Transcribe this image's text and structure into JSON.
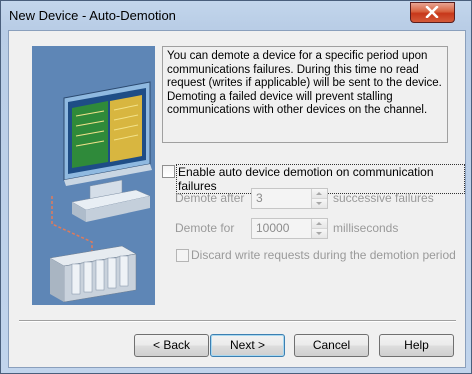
{
  "window": {
    "title": "New Device - Auto-Demotion"
  },
  "description": "You can demote a device for a specific period upon communications failures. During this time no read request (writes if applicable) will be sent to the device. Demoting a failed device will prevent stalling communications with other devices on the channel.",
  "enable": {
    "label": "Enable auto device demotion on communication failures",
    "checked": false
  },
  "demote_after": {
    "label": "Demote after",
    "value": "3",
    "suffix": "successive failures"
  },
  "demote_for": {
    "label": "Demote for",
    "value": "10000",
    "suffix": "milliseconds"
  },
  "discard": {
    "label": "Discard write requests during the demotion period",
    "checked": false
  },
  "buttons": {
    "back": "< Back",
    "next": "Next >",
    "cancel": "Cancel",
    "help": "Help"
  },
  "colors": {
    "art_background": "#5e86b6",
    "close_button": "#c7371a"
  }
}
